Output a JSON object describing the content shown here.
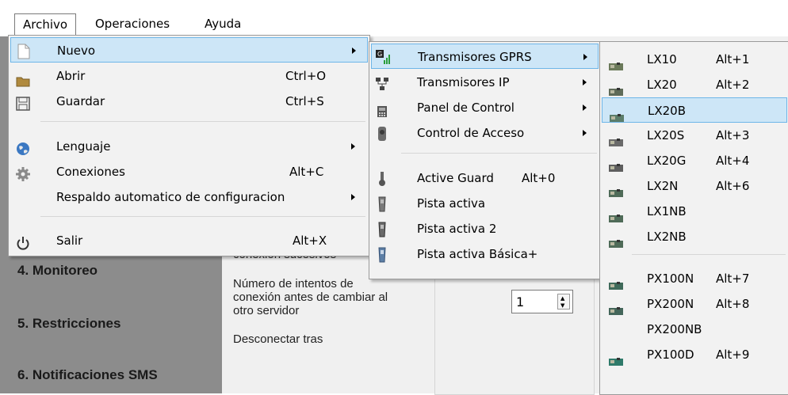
{
  "menubar": {
    "archivo": "Archivo",
    "operaciones": "Operaciones",
    "ayuda": "Ayuda"
  },
  "sidebar": {
    "steps": [
      "4. Monitoreo",
      "5. Restricciones",
      "6. Notificaciones SMS"
    ]
  },
  "form": {
    "label_partial": "conexión sucesivos",
    "label_attempts": "Número de intentos de conexión antes de cambiar al otro servidor",
    "label_attempts_l1": "Número de intentos de",
    "label_attempts_l2": "conexión antes de cambiar al",
    "label_attempts_l3": "otro servidor",
    "label_disconnect": "Desconectar tras",
    "attempts_value": "1"
  },
  "archivo_menu": {
    "items": [
      {
        "label": "Nuevo",
        "shortcut": "",
        "icon": "new-document-icon",
        "submenu": true,
        "highlighted": true
      },
      {
        "label": "Abrir",
        "shortcut": "Ctrl+O",
        "icon": "folder-icon",
        "submenu": false
      },
      {
        "label": "Guardar",
        "shortcut": "Ctrl+S",
        "icon": "save-icon",
        "submenu": false
      },
      {
        "label": "Lenguaje",
        "shortcut": "",
        "icon": "globe-icon",
        "submenu": true
      },
      {
        "label": "Conexiones",
        "shortcut": "Alt+C",
        "icon": "gear-icon",
        "submenu": false
      },
      {
        "label": "Respaldo automatico de configuracion",
        "shortcut": "",
        "icon": "",
        "submenu": true
      },
      {
        "label": "Salir",
        "shortcut": "Alt+X",
        "icon": "power-icon",
        "submenu": false
      }
    ]
  },
  "nuevo_menu": {
    "items": [
      {
        "label": "Transmisores GPRS",
        "shortcut": "",
        "icon": "gprs-signal-icon",
        "submenu": true,
        "highlighted": true
      },
      {
        "label": "Transmisores IP",
        "shortcut": "",
        "icon": "network-icon",
        "submenu": true
      },
      {
        "label": "Panel de Control",
        "shortcut": "",
        "icon": "control-panel-icon",
        "submenu": true
      },
      {
        "label": "Control de Acceso",
        "shortcut": "",
        "icon": "fingerprint-icon",
        "submenu": true
      },
      {
        "label": "Active Guard",
        "shortcut": "Alt+0",
        "icon": "guard-icon",
        "submenu": false
      },
      {
        "label": "Pista activa",
        "shortcut": "",
        "icon": "pista-device-icon",
        "submenu": false
      },
      {
        "label": "Pista activa 2",
        "shortcut": "",
        "icon": "pista-device-icon",
        "submenu": false
      },
      {
        "label": "Pista activa Básica+",
        "shortcut": "",
        "icon": "pista-device-icon",
        "submenu": false
      }
    ]
  },
  "gprs_menu": {
    "items": [
      {
        "label": "LX10",
        "shortcut": "Alt+1",
        "icon": "board-icon"
      },
      {
        "label": "LX20",
        "shortcut": "Alt+2",
        "icon": "board-icon"
      },
      {
        "label": "LX20B",
        "shortcut": "",
        "icon": "board-icon",
        "highlighted": true
      },
      {
        "label": "LX20S",
        "shortcut": "Alt+3",
        "icon": "board-icon"
      },
      {
        "label": "LX20G",
        "shortcut": "Alt+4",
        "icon": "board-icon"
      },
      {
        "label": "LX2N",
        "shortcut": "Alt+6",
        "icon": "board-icon"
      },
      {
        "label": "LX1NB",
        "shortcut": "",
        "icon": "board-icon"
      },
      {
        "label": "LX2NB",
        "shortcut": "",
        "icon": "board-icon"
      },
      {
        "label": "PX100N",
        "shortcut": "Alt+7",
        "icon": "board-icon"
      },
      {
        "label": "PX200N",
        "shortcut": "Alt+8",
        "icon": "board-icon"
      },
      {
        "label": "PX200NB",
        "shortcut": "",
        "icon": ""
      },
      {
        "label": "PX100D",
        "shortcut": "Alt+9",
        "icon": "board-icon"
      }
    ]
  },
  "colors": {
    "highlight_fill": "#cde6f7",
    "highlight_border": "#6eb6e8",
    "menu_bg": "#f2f2f2",
    "sidebar_bg": "#8c8c8c"
  }
}
